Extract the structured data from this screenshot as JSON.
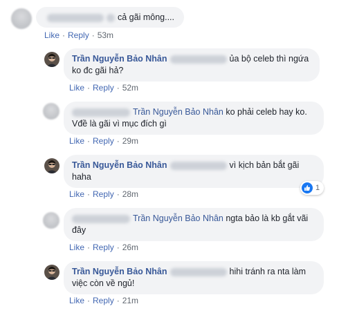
{
  "comments": [
    {
      "author": "",
      "text": "cả gãi mông....",
      "like": "Like",
      "reply": "Reply",
      "time": "53m"
    },
    {
      "author": "Trần Nguyễn Bảo Nhân",
      "text_line1": "ủa bộ celeb thì ngứa",
      "text_line2": "ko đc gãi hả?",
      "like": "Like",
      "reply": "Reply",
      "time": "52m"
    },
    {
      "author": "Trần Nguyễn Bảo Nhân",
      "text_line1": "ko phải celeb hay ko.",
      "text_line2": "Vđề là gãi vì mục đích gì",
      "like": "Like",
      "reply": "Reply",
      "time": "29m"
    },
    {
      "author": "Trần Nguyễn Bảo Nhân",
      "text_line1": "vì kịch bản bắt gãi",
      "text_line2": "haha",
      "like": "Like",
      "reply": "Reply",
      "time": "28m",
      "reaction_count": "1"
    },
    {
      "author": "Trần Nguyễn Bảo Nhân",
      "text_line1": "ngta bảo là kb gắt vãi",
      "text_line2": "đây",
      "like": "Like",
      "reply": "Reply",
      "time": "26m"
    },
    {
      "author": "Trần Nguyễn Bảo Nhân",
      "text_line1": "hihi tránh ra nta làm",
      "text_line2": "việc còn về ngủ!",
      "like": "Like",
      "reply": "Reply",
      "time": "21m"
    }
  ],
  "colors": {
    "name": "#385898",
    "link": "#4267b2",
    "bubble": "#f2f3f5",
    "like_badge": "#1877f2"
  }
}
